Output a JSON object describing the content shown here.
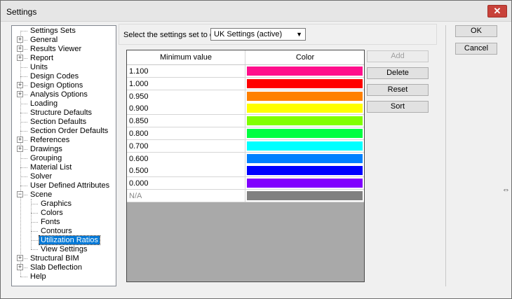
{
  "window": {
    "title": "Settings",
    "close_glyph": "✕"
  },
  "tree": {
    "items": [
      {
        "label": "Settings Sets",
        "level": 0,
        "expander": false
      },
      {
        "label": "General",
        "level": 0,
        "expander": true
      },
      {
        "label": "Results Viewer",
        "level": 0,
        "expander": true
      },
      {
        "label": "Report",
        "level": 0,
        "expander": true
      },
      {
        "label": "Units",
        "level": 0,
        "expander": false
      },
      {
        "label": "Design Codes",
        "level": 0,
        "expander": false
      },
      {
        "label": "Design Options",
        "level": 0,
        "expander": true
      },
      {
        "label": "Analysis Options",
        "level": 0,
        "expander": true
      },
      {
        "label": "Loading",
        "level": 0,
        "expander": false
      },
      {
        "label": "Structure Defaults",
        "level": 0,
        "expander": false
      },
      {
        "label": "Section Defaults",
        "level": 0,
        "expander": false
      },
      {
        "label": "Section Order Defaults",
        "level": 0,
        "expander": false
      },
      {
        "label": "References",
        "level": 0,
        "expander": true
      },
      {
        "label": "Drawings",
        "level": 0,
        "expander": true
      },
      {
        "label": "Grouping",
        "level": 0,
        "expander": false
      },
      {
        "label": "Material List",
        "level": 0,
        "expander": false
      },
      {
        "label": "Solver",
        "level": 0,
        "expander": false
      },
      {
        "label": "User Defined Attributes",
        "level": 0,
        "expander": false
      },
      {
        "label": "Scene",
        "level": 0,
        "expander": true,
        "expanded": true
      },
      {
        "label": "Graphics",
        "level": 1,
        "expander": false
      },
      {
        "label": "Colors",
        "level": 1,
        "expander": false
      },
      {
        "label": "Fonts",
        "level": 1,
        "expander": false
      },
      {
        "label": "Contours",
        "level": 1,
        "expander": false
      },
      {
        "label": "Utilization Ratios",
        "level": 1,
        "expander": false,
        "selected": true
      },
      {
        "label": "View Settings",
        "level": 1,
        "expander": false
      },
      {
        "label": "Structural BIM",
        "level": 0,
        "expander": true
      },
      {
        "label": "Slab Deflection",
        "level": 0,
        "expander": true
      },
      {
        "label": "Help",
        "level": 0,
        "expander": false
      }
    ]
  },
  "settings_set": {
    "label": "Select the settings set to edit:",
    "value": "UK Settings (active)"
  },
  "grid": {
    "headers": {
      "min": "Minimum value",
      "color": "Color"
    },
    "rows": [
      {
        "min": "1.100",
        "color": "#ff0f8c"
      },
      {
        "min": "1.000",
        "color": "#ff0000"
      },
      {
        "min": "0.950",
        "color": "#ff8000"
      },
      {
        "min": "0.900",
        "color": "#ffff00"
      },
      {
        "min": "0.850",
        "color": "#80ff00"
      },
      {
        "min": "0.800",
        "color": "#00ff40"
      },
      {
        "min": "0.700",
        "color": "#00ffff"
      },
      {
        "min": "0.600",
        "color": "#0080ff"
      },
      {
        "min": "0.500",
        "color": "#0000ff"
      },
      {
        "min": "0.000",
        "color": "#8000ff"
      },
      {
        "min": "N/A",
        "color": "#808080",
        "na": true
      }
    ]
  },
  "buttons": {
    "add": "Add",
    "delete": "Delete",
    "reset": "Reset",
    "sort": "Sort",
    "ok": "OK",
    "cancel": "Cancel"
  }
}
